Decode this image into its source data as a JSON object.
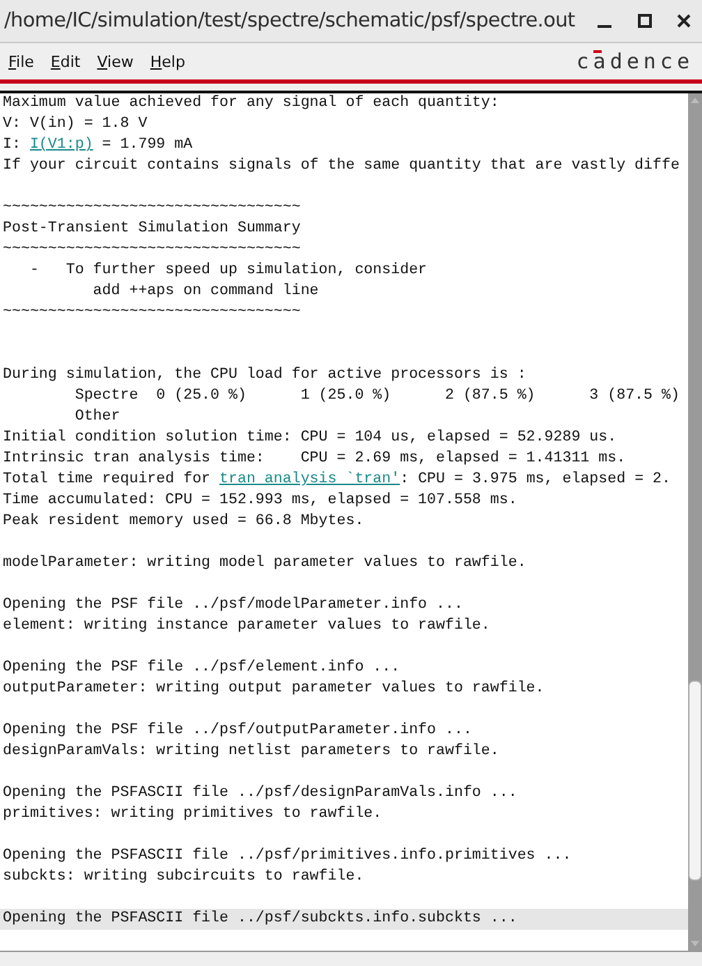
{
  "window": {
    "title": "/home/IC/simulation/test/spectre/schematic/psf/spectre.out"
  },
  "menu": [
    {
      "label": "File"
    },
    {
      "label": "Edit"
    },
    {
      "label": "View"
    },
    {
      "label": "Help"
    }
  ],
  "logo": "cadence",
  "lines": [
    {
      "kind": "text",
      "text": "Maximum value achieved for any signal of each quantity:",
      "selected": false
    },
    {
      "kind": "text",
      "text": "V: V(in) = 1.8 V",
      "selected": false
    },
    {
      "kind": "link",
      "before": "I: ",
      "link": "I(V1:p)",
      "after": " = 1.799 mA",
      "selected": false
    },
    {
      "kind": "text",
      "text": "If your circuit contains signals of the same quantity that are vastly diffe",
      "selected": false
    },
    {
      "kind": "blank"
    },
    {
      "kind": "text",
      "text": "~~~~~~~~~~~~~~~~~~~~~~~~~~~~~~~~~",
      "selected": false
    },
    {
      "kind": "text",
      "text": "Post-Transient Simulation Summary",
      "selected": false
    },
    {
      "kind": "text",
      "text": "~~~~~~~~~~~~~~~~~~~~~~~~~~~~~~~~~",
      "selected": false
    },
    {
      "kind": "text",
      "text": "   -   To further speed up simulation, consider",
      "selected": false
    },
    {
      "kind": "text",
      "text": "          add ++aps on command line",
      "selected": false
    },
    {
      "kind": "text",
      "text": "~~~~~~~~~~~~~~~~~~~~~~~~~~~~~~~~~",
      "selected": false
    },
    {
      "kind": "blank"
    },
    {
      "kind": "blank"
    },
    {
      "kind": "text",
      "text": "During simulation, the CPU load for active processors is :",
      "selected": false
    },
    {
      "kind": "text",
      "text": "        Spectre  0 (25.0 %)      1 (25.0 %)      2 (87.5 %)      3 (87.5 %)",
      "selected": false
    },
    {
      "kind": "text",
      "text": "        Other",
      "selected": false
    },
    {
      "kind": "text",
      "text": "Initial condition solution time: CPU = 104 us, elapsed = 52.9289 us.",
      "selected": false
    },
    {
      "kind": "text",
      "text": "Intrinsic tran analysis time:    CPU = 2.69 ms, elapsed = 1.41311 ms.",
      "selected": false
    },
    {
      "kind": "link",
      "before": "Total time required for ",
      "link": "tran analysis `tran'",
      "after": ": CPU = 3.975 ms, elapsed = 2.",
      "selected": false
    },
    {
      "kind": "text",
      "text": "Time accumulated: CPU = 152.993 ms, elapsed = 107.558 ms.",
      "selected": false
    },
    {
      "kind": "text",
      "text": "Peak resident memory used = 66.8 Mbytes.",
      "selected": false
    },
    {
      "kind": "blank"
    },
    {
      "kind": "text",
      "text": "modelParameter: writing model parameter values to rawfile.",
      "selected": false
    },
    {
      "kind": "blank"
    },
    {
      "kind": "text",
      "text": "Opening the PSF file ../psf/modelParameter.info ...",
      "selected": false
    },
    {
      "kind": "text",
      "text": "element: writing instance parameter values to rawfile.",
      "selected": false
    },
    {
      "kind": "blank"
    },
    {
      "kind": "text",
      "text": "Opening the PSF file ../psf/element.info ...",
      "selected": false
    },
    {
      "kind": "text",
      "text": "outputParameter: writing output parameter values to rawfile.",
      "selected": false
    },
    {
      "kind": "blank"
    },
    {
      "kind": "text",
      "text": "Opening the PSF file ../psf/outputParameter.info ...",
      "selected": false
    },
    {
      "kind": "text",
      "text": "designParamVals: writing netlist parameters to rawfile.",
      "selected": false
    },
    {
      "kind": "blank"
    },
    {
      "kind": "text",
      "text": "Opening the PSFASCII file ../psf/designParamVals.info ...",
      "selected": false
    },
    {
      "kind": "text",
      "text": "primitives: writing primitives to rawfile.",
      "selected": false
    },
    {
      "kind": "blank"
    },
    {
      "kind": "text",
      "text": "Opening the PSFASCII file ../psf/primitives.info.primitives ...",
      "selected": false
    },
    {
      "kind": "text",
      "text": "subckts: writing subcircuits to rawfile.",
      "selected": false
    },
    {
      "kind": "blank"
    },
    {
      "kind": "text",
      "text": "Opening the PSFASCII file ../psf/subckts.info.subckts ...",
      "selected": true
    }
  ]
}
